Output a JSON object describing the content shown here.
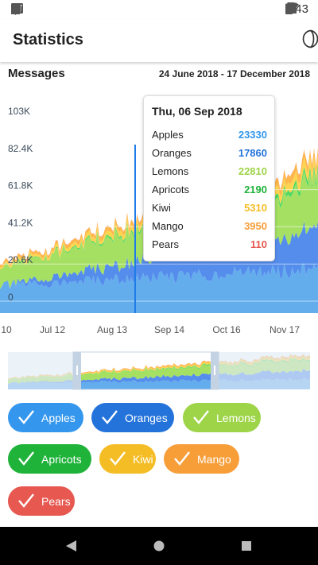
{
  "status_bar": {
    "time": "3:43"
  },
  "app_bar": {
    "title": "Statistics",
    "theme_icon": "moon-icon"
  },
  "chart_header": {
    "title": "Messages",
    "date_range": "24 June 2018 - 17 December 2018"
  },
  "chart_data": {
    "type": "area",
    "ytick_labels": [
      "0",
      "20.6K",
      "41.2K",
      "61.8K",
      "82.4K",
      "103K"
    ],
    "ytick_values": [
      0,
      20600,
      41200,
      61800,
      82400,
      103000
    ],
    "xtick_labels": [
      "10",
      "Jul 12",
      "Aug 13",
      "Sep 14",
      "Oct 16",
      "Nov 17"
    ],
    "series": [
      {
        "name": "Apples",
        "color": "#64ADED",
        "start": 17000,
        "end": 28000
      },
      {
        "name": "Oranges",
        "color": "#558DED",
        "start": 0,
        "end": 24000
      },
      {
        "name": "Lemons",
        "color": "#A5E063",
        "start": 11000,
        "end": 30000
      },
      {
        "name": "Apricots",
        "color": "#4BD964",
        "start": 0,
        "end": 3000
      },
      {
        "name": "Kiwi",
        "color": "#FFD54F",
        "start": 1000,
        "end": 6000
      },
      {
        "name": "Mango",
        "color": "#FFB74D",
        "start": 1500,
        "end": 5000
      },
      {
        "name": "Pears",
        "color": "#F9A8A0",
        "start": 200,
        "end": 400
      }
    ]
  },
  "tooltip": {
    "date": "Thu, 06 Sep 2018",
    "rows": [
      {
        "name": "Apples",
        "value": "23330",
        "color": "#3497ED"
      },
      {
        "name": "Oranges",
        "value": "17860",
        "color": "#2373DB"
      },
      {
        "name": "Lemons",
        "value": "22810",
        "color": "#9ED448"
      },
      {
        "name": "Apricots",
        "value": "2190",
        "color": "#20B33A"
      },
      {
        "name": "Kiwi",
        "value": "5310",
        "color": "#F5BD25"
      },
      {
        "name": "Mango",
        "value": "3950",
        "color": "#F79E39"
      },
      {
        "name": "Pears",
        "value": "110",
        "color": "#E65850"
      }
    ]
  },
  "chips": [
    {
      "label": "Apples",
      "color": "#3497ED"
    },
    {
      "label": "Oranges",
      "color": "#2373DB"
    },
    {
      "label": "Lemons",
      "color": "#9ED448"
    },
    {
      "label": "Apricots",
      "color": "#20B33A"
    },
    {
      "label": "Kiwi",
      "color": "#F5BD25"
    },
    {
      "label": "Mango",
      "color": "#F79E39"
    },
    {
      "label": "Pears",
      "color": "#E65850"
    }
  ]
}
